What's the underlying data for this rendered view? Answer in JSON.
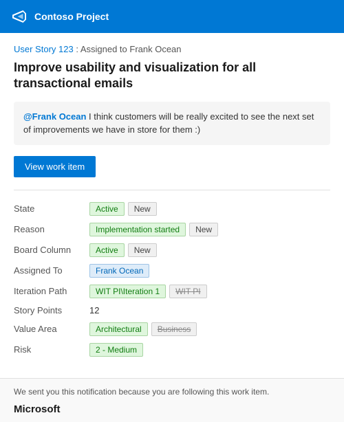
{
  "header": {
    "title": "Contoso Project",
    "logo_alt": "Microsoft Visual Studio Team Services logo"
  },
  "breadcrumb": {
    "link_text": "User Story 123",
    "separator": " : ",
    "description": "Assigned to Frank Ocean"
  },
  "work_item": {
    "title": "Improve usability and visualization for all transactional emails"
  },
  "comment": {
    "mention": "@Frank Ocean",
    "text": " I think customers will be really excited to see the next set of improvements we have in store for them :)"
  },
  "button": {
    "view_work_item": "View work item"
  },
  "fields": [
    {
      "label": "State",
      "values": [
        {
          "text": "Active",
          "style": "green"
        },
        {
          "text": "New",
          "style": "gray"
        }
      ]
    },
    {
      "label": "Reason",
      "values": [
        {
          "text": "Implementation started",
          "style": "green"
        },
        {
          "text": "New",
          "style": "gray"
        }
      ]
    },
    {
      "label": "Board Column",
      "values": [
        {
          "text": "Active",
          "style": "green"
        },
        {
          "text": "New",
          "style": "gray"
        }
      ]
    },
    {
      "label": "Assigned To",
      "values": [
        {
          "text": "Frank Ocean",
          "style": "blue"
        }
      ]
    },
    {
      "label": "Iteration Path",
      "values": [
        {
          "text": "WIT PI\\Iteration 1",
          "style": "green"
        },
        {
          "text": "WIT PI",
          "style": "strikethrough"
        }
      ]
    },
    {
      "label": "Story Points",
      "values": [
        {
          "text": "12",
          "style": "plain"
        }
      ]
    },
    {
      "label": "Value Area",
      "values": [
        {
          "text": "Architectural",
          "style": "green"
        },
        {
          "text": "Business",
          "style": "strikethrough"
        }
      ]
    },
    {
      "label": "Risk",
      "values": [
        {
          "text": "2 - Medium",
          "style": "green"
        }
      ]
    }
  ],
  "footer": {
    "note": "We sent you this notification because you are following this work item.",
    "brand": "Microsoft"
  }
}
